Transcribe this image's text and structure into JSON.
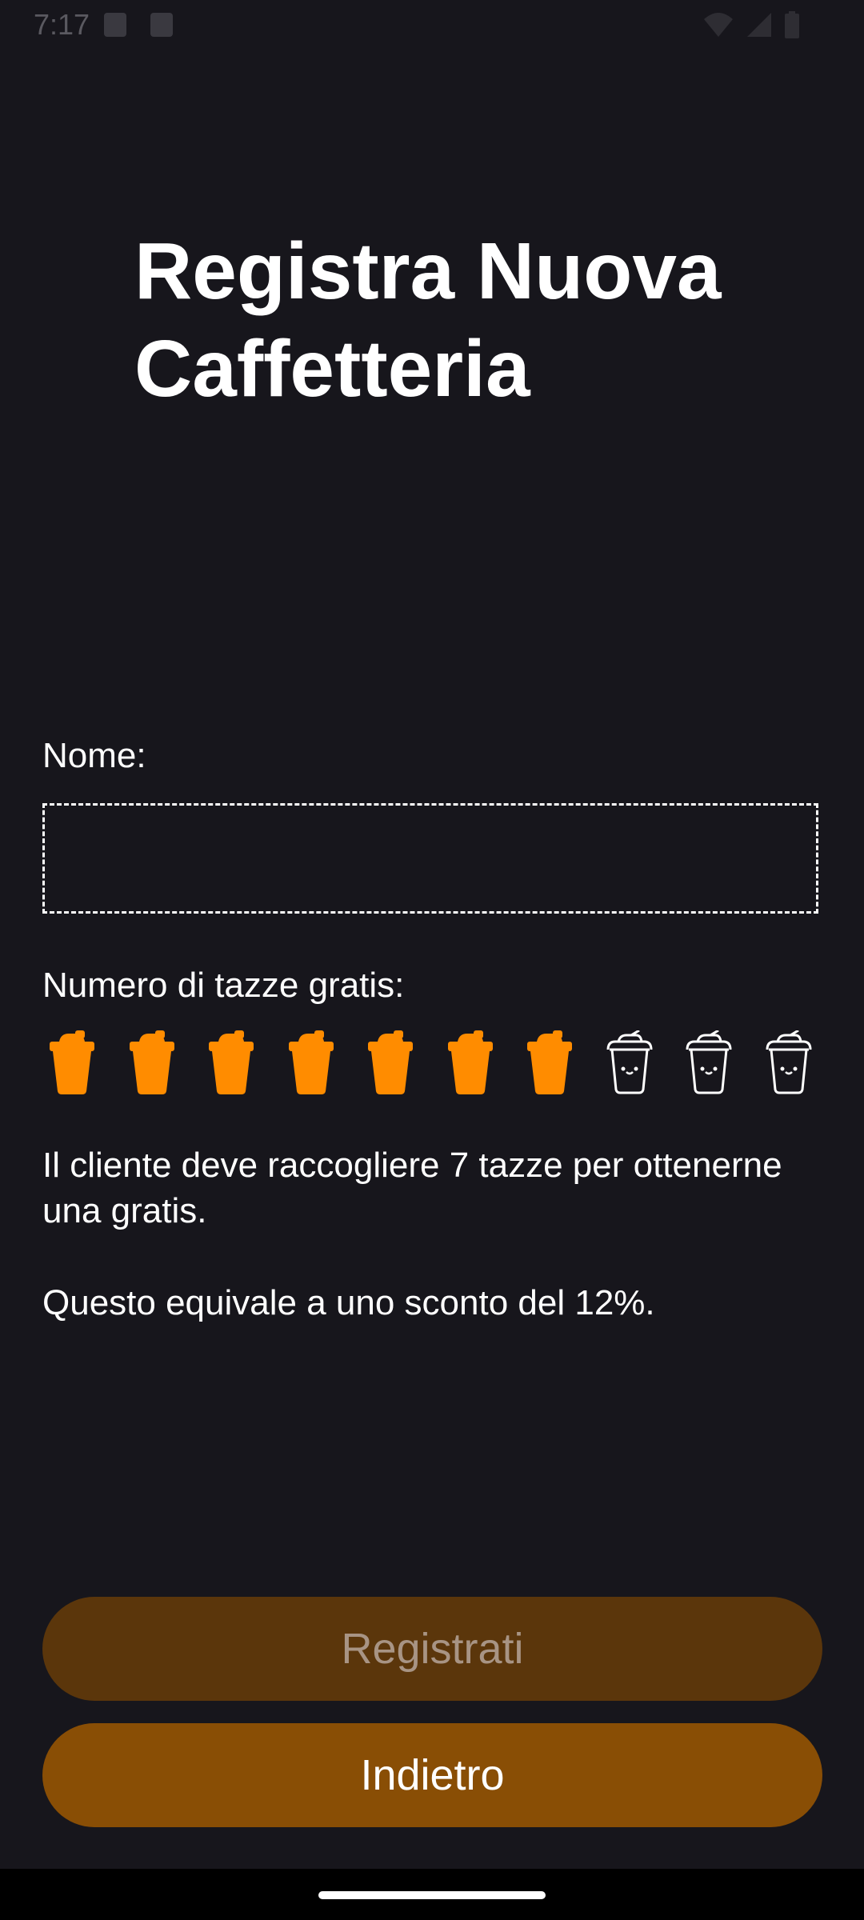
{
  "status_bar": {
    "time": "7:17",
    "icons": [
      "notification-icon",
      "sim-card-icon",
      "wifi-icon",
      "signal-icon",
      "battery-icon"
    ]
  },
  "title": "Registra Nuova Caffetteria",
  "form": {
    "name_label": "Nome:",
    "name_value": "",
    "name_placeholder": "",
    "cups_label": "Numero di tazze gratis:",
    "cups_total": 10,
    "cups_selected": 7,
    "description": "Il cliente deve raccogliere 7 tazze per ottenerne una gratis.",
    "discount": "Questo equivale a uno sconto del 12%."
  },
  "buttons": {
    "register_label": "Registrati",
    "back_label": "Indietro"
  },
  "colors": {
    "background": "#17161c",
    "accent": "#ff8c00",
    "cup_outline": "#ffffff",
    "register_bg": "#5b360b",
    "back_bg": "#894e05"
  }
}
